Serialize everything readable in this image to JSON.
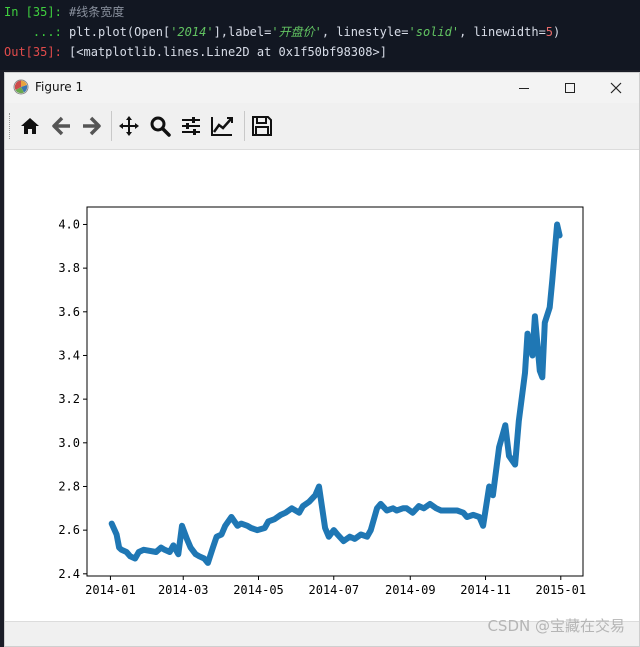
{
  "console": {
    "in_prompt": "In [35]:",
    "comment": "#线条宽度",
    "cont_prompt": "...:",
    "code_pre": "plt.plot(Open[",
    "code_str1": "'2014'",
    "code_mid1": "],label=",
    "code_str2": "'开盘价'",
    "code_mid2": ", linestyle=",
    "code_str3": "'solid'",
    "code_mid3": ", linewidth=",
    "code_num": "5",
    "code_end": ")",
    "out_prompt": "Out[35]:",
    "out_text": "[<matplotlib.lines.Line2D at 0x1f50bf98308>]"
  },
  "window": {
    "title": "Figure 1",
    "icon": "matplotlib-icon"
  },
  "toolbar": {
    "icons": [
      "home-icon",
      "back-arrow-icon",
      "forward-arrow-icon",
      "pan-icon",
      "zoom-icon",
      "configure-subplots-icon",
      "edit-axis-icon",
      "save-icon"
    ]
  },
  "watermark": "CSDN @宝藏在交易",
  "chart_data": {
    "type": "line",
    "color": "#1f77b4",
    "linewidth": 5,
    "x_ticks": [
      "2014-01",
      "2014-03",
      "2014-05",
      "2014-07",
      "2014-09",
      "2014-11",
      "2015-01"
    ],
    "y_ticks": [
      "2.4",
      "2.6",
      "2.8",
      "3.0",
      "3.2",
      "3.4",
      "3.6",
      "3.8",
      "4.0"
    ],
    "xlim": [
      "2013-12-13",
      "2015-01-19"
    ],
    "ylim": [
      2.39,
      4.08
    ],
    "series": [
      {
        "x": [
          "2014-01-02",
          "2014-01-06",
          "2014-01-08",
          "2014-01-10",
          "2014-01-14",
          "2014-01-17",
          "2014-01-21",
          "2014-01-24",
          "2014-01-28",
          "2014-02-07",
          "2014-02-11",
          "2014-02-14",
          "2014-02-18",
          "2014-02-21",
          "2014-02-25",
          "2014-02-28",
          "2014-03-04",
          "2014-03-07",
          "2014-03-11",
          "2014-03-14",
          "2014-03-18",
          "2014-03-21",
          "2014-03-25",
          "2014-03-28",
          "2014-04-01",
          "2014-04-04",
          "2014-04-09",
          "2014-04-14",
          "2014-04-17",
          "2014-04-22",
          "2014-04-25",
          "2014-04-30",
          "2014-05-06",
          "2014-05-09",
          "2014-05-14",
          "2014-05-19",
          "2014-05-23",
          "2014-05-28",
          "2014-06-03",
          "2014-06-06",
          "2014-06-11",
          "2014-06-16",
          "2014-06-19",
          "2014-06-24",
          "2014-06-27",
          "2014-07-01",
          "2014-07-04",
          "2014-07-09",
          "2014-07-14",
          "2014-07-18",
          "2014-07-23",
          "2014-07-28",
          "2014-07-31",
          "2014-08-05",
          "2014-08-08",
          "2014-08-13",
          "2014-08-18",
          "2014-08-21",
          "2014-08-26",
          "2014-08-29",
          "2014-09-03",
          "2014-09-08",
          "2014-09-12",
          "2014-09-17",
          "2014-09-22",
          "2014-09-26",
          "2014-10-09",
          "2014-10-14",
          "2014-10-17",
          "2014-10-22",
          "2014-10-27",
          "2014-10-30",
          "2014-11-04",
          "2014-11-07",
          "2014-11-12",
          "2014-11-17",
          "2014-11-20",
          "2014-11-25",
          "2014-11-28",
          "2014-12-03",
          "2014-12-05",
          "2014-12-09",
          "2014-12-11",
          "2014-12-15",
          "2014-12-17",
          "2014-12-19",
          "2014-12-23",
          "2014-12-25",
          "2014-12-29",
          "2014-12-31"
        ],
        "y": [
          2.63,
          2.58,
          2.52,
          2.51,
          2.5,
          2.48,
          2.47,
          2.5,
          2.51,
          2.5,
          2.52,
          2.51,
          2.5,
          2.53,
          2.49,
          2.62,
          2.56,
          2.52,
          2.49,
          2.48,
          2.47,
          2.45,
          2.52,
          2.57,
          2.58,
          2.62,
          2.66,
          2.62,
          2.63,
          2.62,
          2.61,
          2.6,
          2.61,
          2.64,
          2.65,
          2.67,
          2.68,
          2.7,
          2.68,
          2.71,
          2.73,
          2.76,
          2.8,
          2.61,
          2.57,
          2.6,
          2.58,
          2.55,
          2.57,
          2.56,
          2.58,
          2.57,
          2.6,
          2.7,
          2.72,
          2.69,
          2.7,
          2.69,
          2.7,
          2.7,
          2.68,
          2.71,
          2.7,
          2.72,
          2.7,
          2.69,
          2.69,
          2.68,
          2.66,
          2.67,
          2.66,
          2.62,
          2.8,
          2.76,
          2.98,
          3.08,
          2.94,
          2.9,
          3.1,
          3.32,
          3.5,
          3.4,
          3.58,
          3.33,
          3.3,
          3.55,
          3.62,
          3.74,
          4.0,
          3.95
        ]
      }
    ]
  }
}
